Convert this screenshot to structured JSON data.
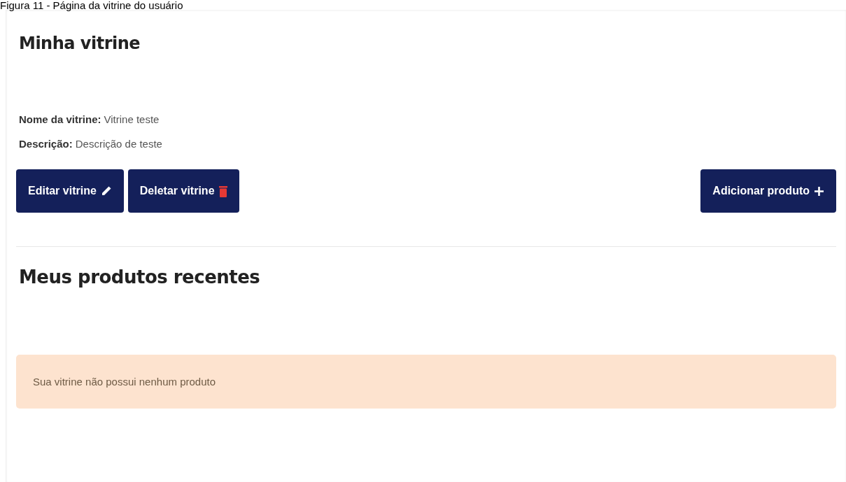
{
  "caption": "Figura 11 - Página da vitrine do usuário",
  "page": {
    "title": "Minha vitrine",
    "fields": [
      {
        "label": "Nome da vitrine:",
        "value": "Vitrine teste"
      },
      {
        "label": "Descrição:",
        "value": "Descrição de teste"
      }
    ],
    "actions": [
      {
        "kind": "edit",
        "label": "Editar vitrine"
      },
      {
        "kind": "delete",
        "label": "Deletar vitrine"
      },
      {
        "kind": "add",
        "label": "Adicionar produto"
      }
    ],
    "section_title": "Meus produtos recentes",
    "alert": "Sua vitrine não possui nenhum produto"
  }
}
